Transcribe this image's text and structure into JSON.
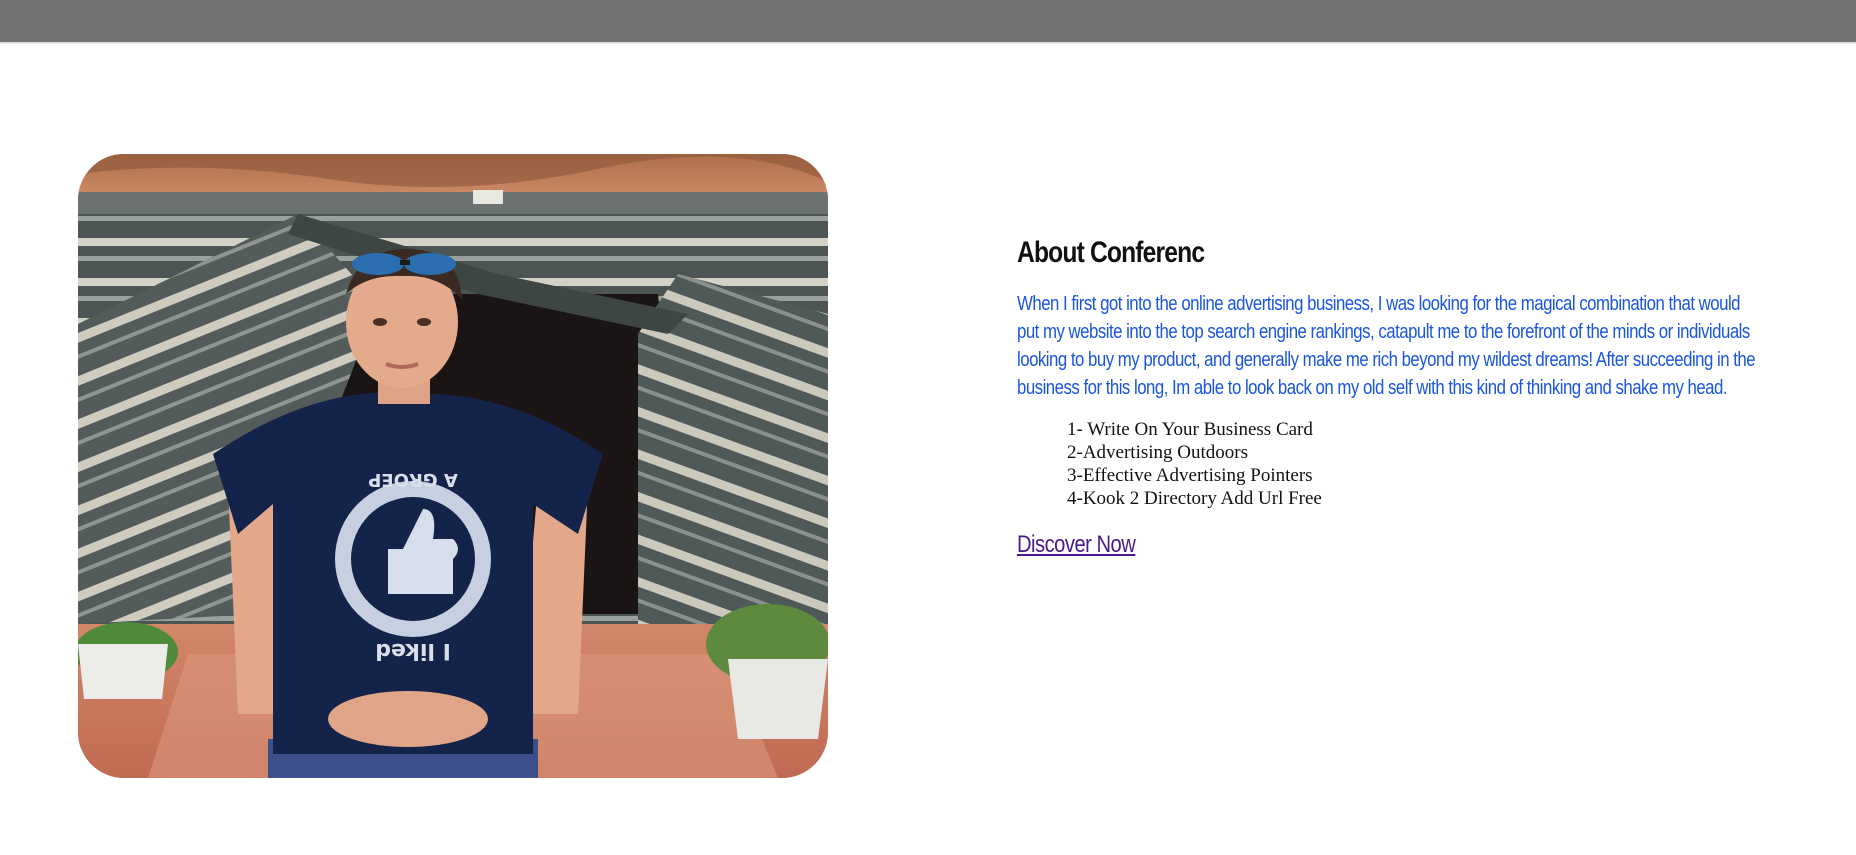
{
  "about": {
    "heading": "About Conferenc",
    "paragraph": "When I first got into the online advertising business, I was looking for the magical combination that would put my website into the top search engine rankings, catapult me to the forefront of the minds or individuals looking to buy my product, and generally make me rich beyond my wildest dreams! After succeeding in the business for this long, Im able to look back on my old self with this kind of thinking and shake my head.",
    "list": [
      "1- Write On Your Business Card",
      "2-Advertising Outdoors",
      "3-Effective Advertising Pointers",
      "4-Kook 2 Directory Add Url Free"
    ],
    "cta_label": "Discover Now"
  },
  "photo": {
    "shirt_text_top": "A GROEP",
    "shirt_text_bottom": "I liked"
  },
  "colors": {
    "topbar": "#727272",
    "paragraph": "#1a55e0",
    "link": "#4b1a8a",
    "heading": "#111111"
  }
}
